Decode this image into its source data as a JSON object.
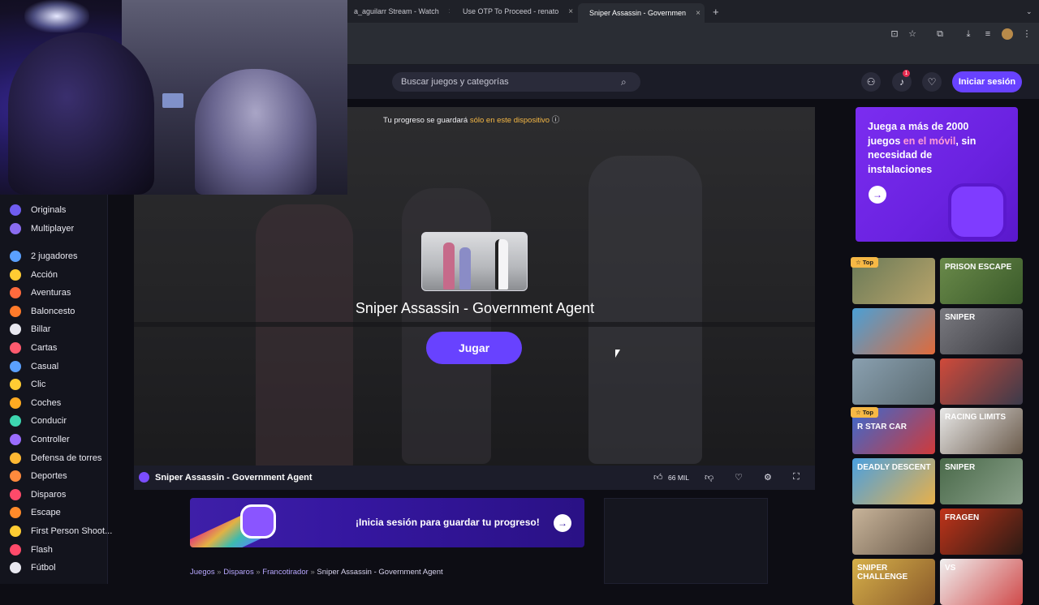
{
  "browser": {
    "tabs": [
      {
        "label": "a_aguilarr Stream - Watch",
        "close": "×"
      },
      {
        "label": "Use OTP To Proceed - renato",
        "close": "×"
      },
      {
        "label": "Sniper Assassin - Governmen",
        "close": "×"
      }
    ],
    "new_tab": "+"
  },
  "header": {
    "search_placeholder": "Buscar juegos y categorías",
    "notification_count": "1",
    "login_label": "Iniciar sesión"
  },
  "sidebar": {
    "items": [
      {
        "label": "Originals",
        "color": "#6f5cf0"
      },
      {
        "label": "Multiplayer",
        "color": "#8a6cf0"
      },
      {
        "label": "2 jugadores",
        "color": "#5aa0ff"
      },
      {
        "label": "Acción",
        "color": "#ffcc33"
      },
      {
        "label": "Aventuras",
        "color": "#ff6a3d"
      },
      {
        "label": "Baloncesto",
        "color": "#ff7a2a"
      },
      {
        "label": "Billar",
        "color": "#e8e8f0"
      },
      {
        "label": "Cartas",
        "color": "#ff5a6e"
      },
      {
        "label": "Casual",
        "color": "#5aa0ff"
      },
      {
        "label": "Clic",
        "color": "#ffcc33"
      },
      {
        "label": "Coches",
        "color": "#ffaa22"
      },
      {
        "label": "Conducir",
        "color": "#3dd6b0"
      },
      {
        "label": "Controller",
        "color": "#9a6cff"
      },
      {
        "label": "Defensa de torres",
        "color": "#ffb833"
      },
      {
        "label": "Deportes",
        "color": "#ff8a3d"
      },
      {
        "label": "Disparos",
        "color": "#ff4a6a"
      },
      {
        "label": "Escape",
        "color": "#ff8a2a"
      },
      {
        "label": "First Person Shoot...",
        "color": "#ffcc33"
      },
      {
        "label": "Flash",
        "color": "#ff4a6a"
      },
      {
        "label": "Fútbol",
        "color": "#e8e8f0"
      }
    ]
  },
  "game": {
    "progress_prefix": "Tu progreso se guardará",
    "progress_highlight": "sólo en este dispositivo",
    "title": "Sniper Assassin - Government Agent",
    "play_label": "Jugar",
    "bar_title": "Sniper Assassin - Government Agent",
    "likes": "66 MIL"
  },
  "banner": {
    "text": "¡Inicia sesión para guardar tu progreso!"
  },
  "breadcrumb": {
    "items": [
      "Juegos",
      "Disparos",
      "Francotirador"
    ],
    "current": "Sniper Assassin - Government Agent",
    "sep": "»"
  },
  "ad": {
    "line1": "Juega a más de 2000 juegos ",
    "highlight": "en el móvil",
    "line2": ", sin necesidad de instalaciones"
  },
  "grid": {
    "top_label": "Top",
    "tiles": [
      {
        "label": "",
        "badge": true
      },
      {
        "label": "PRISON ESCAPE",
        "badge": false
      },
      {
        "label": "",
        "badge": false
      },
      {
        "label": "SNIPER",
        "badge": false
      },
      {
        "label": "",
        "badge": false
      },
      {
        "label": "",
        "badge": false
      },
      {
        "label": "R STAR CAR",
        "badge": true
      },
      {
        "label": "RACING LIMITS",
        "badge": false
      },
      {
        "label": "DEADLY DESCENT",
        "badge": false
      },
      {
        "label": "SNIPER",
        "badge": false
      },
      {
        "label": "",
        "badge": false
      },
      {
        "label": "FRAGEN",
        "badge": false
      },
      {
        "label": "SNIPER CHALLENGE",
        "badge": false
      },
      {
        "label": "VS",
        "badge": false
      }
    ]
  }
}
